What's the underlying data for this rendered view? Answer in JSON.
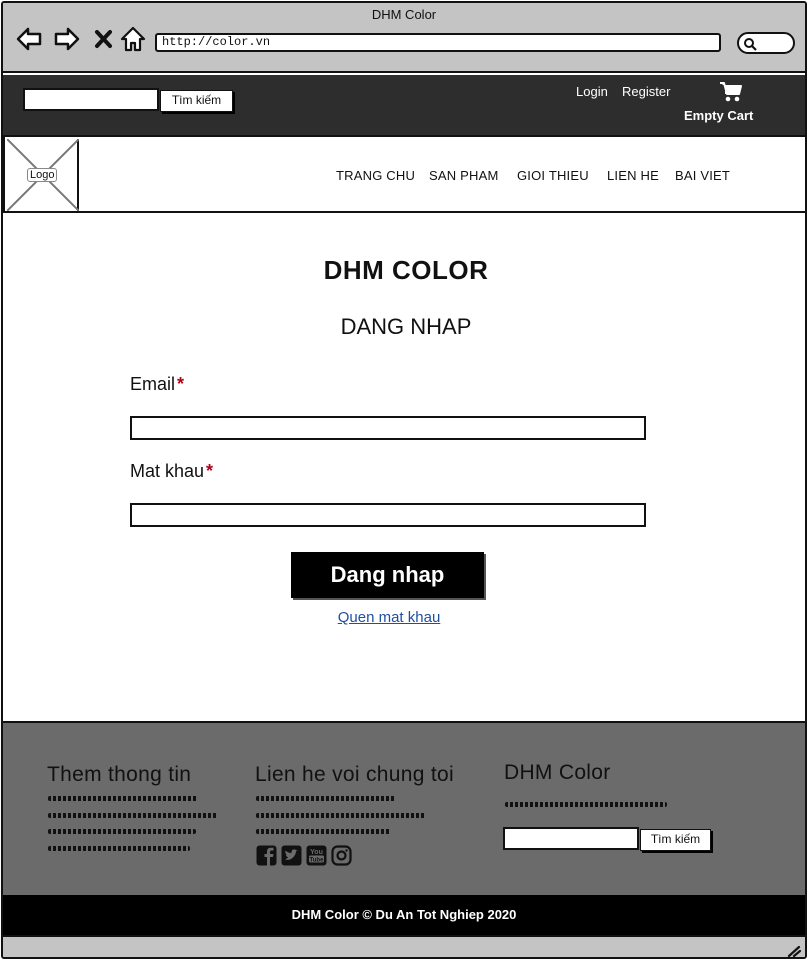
{
  "browser": {
    "window_title": "DHM Color",
    "url": "http://color.vn"
  },
  "topbar": {
    "search_button": "Tìm kiếm",
    "login": "Login",
    "register": "Register",
    "cart": "Empty Cart"
  },
  "header": {
    "logo": "Logo",
    "nav": [
      "TRANG CHU",
      "SAN PHAM",
      "GIOI THIEU",
      "LIEN HE",
      "BAI VIET"
    ]
  },
  "main": {
    "brand": "DHM COLOR",
    "page_title": "DANG NHAP",
    "email_label": "Email",
    "password_label": "Mat khau",
    "required_mark": "*",
    "submit": "Dang nhap",
    "forgot": "Quen mat khau"
  },
  "footer": {
    "col1_title": "Them thong tin",
    "col2_title": "Lien he voi chung toi",
    "col3_title": "DHM Color",
    "search_button": "Tìm kiếm",
    "social_icons": [
      "facebook-icon",
      "twitter-icon",
      "youtube-icon",
      "instagram-icon"
    ],
    "copyright": "DHM Color © Du An Tot Nghiep 2020"
  },
  "colors": {
    "chrome": "#c4c4c4",
    "topbar": "#2d2d2d",
    "footer": "#6b6b6b",
    "required": "#b0001a",
    "link": "#1f4fa3"
  }
}
